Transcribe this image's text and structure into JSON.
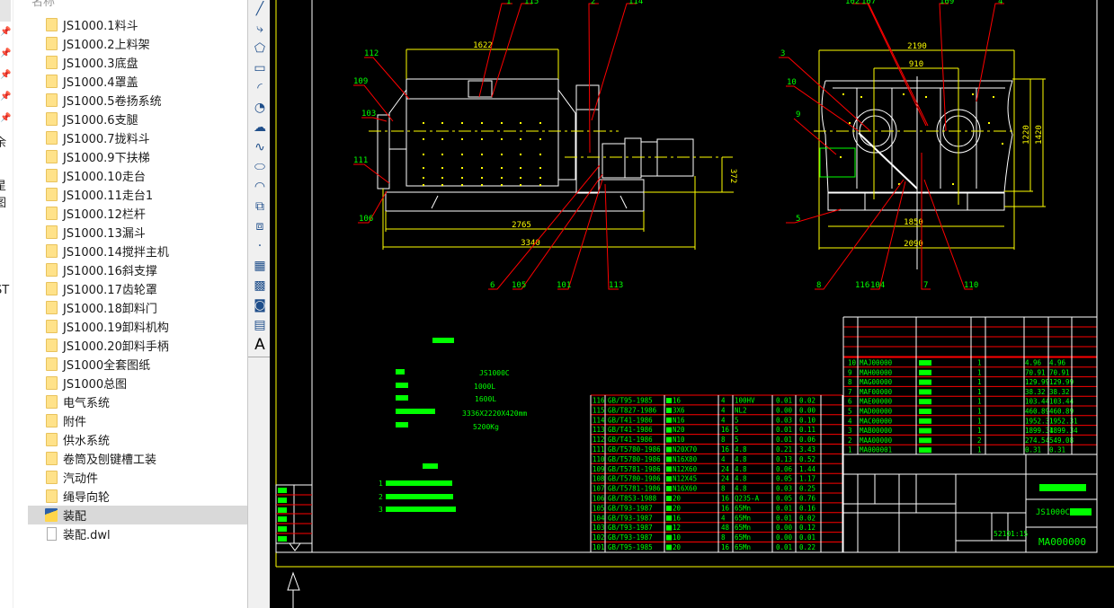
{
  "nav": {
    "fragments": [
      "余",
      "星图",
      "ST"
    ]
  },
  "explorer": {
    "column_header": "名称",
    "items": [
      {
        "label": "JS1000.1料斗",
        "type": "folder"
      },
      {
        "label": "JS1000.2上料架",
        "type": "folder"
      },
      {
        "label": "JS1000.3底盘",
        "type": "folder"
      },
      {
        "label": "JS1000.4罩盖",
        "type": "folder"
      },
      {
        "label": "JS1000.5卷扬系统",
        "type": "folder"
      },
      {
        "label": "JS1000.6支腿",
        "type": "folder"
      },
      {
        "label": "JS1000.7拢料斗",
        "type": "folder"
      },
      {
        "label": "JS1000.9下扶梯",
        "type": "folder"
      },
      {
        "label": "JS1000.10走台",
        "type": "folder"
      },
      {
        "label": "JS1000.11走台1",
        "type": "folder"
      },
      {
        "label": "JS1000.12栏杆",
        "type": "folder"
      },
      {
        "label": "JS1000.13漏斗",
        "type": "folder"
      },
      {
        "label": "JS1000.14搅拌主机",
        "type": "folder"
      },
      {
        "label": "JS1000.16斜支撑",
        "type": "folder"
      },
      {
        "label": "JS1000.17齿轮罩",
        "type": "folder"
      },
      {
        "label": "JS1000.18卸料门",
        "type": "folder"
      },
      {
        "label": "JS1000.19卸料机构",
        "type": "folder"
      },
      {
        "label": "JS1000.20卸料手柄",
        "type": "folder"
      },
      {
        "label": "JS1000全套图纸",
        "type": "folder"
      },
      {
        "label": "JS1000总图",
        "type": "folder"
      },
      {
        "label": "电气系统",
        "type": "folder"
      },
      {
        "label": "附件",
        "type": "folder"
      },
      {
        "label": "供水系统",
        "type": "folder"
      },
      {
        "label": "卷筒及刨键槽工装",
        "type": "folder"
      },
      {
        "label": "汽动件",
        "type": "folder"
      },
      {
        "label": "绳导向轮",
        "type": "folder"
      },
      {
        "label": "装配",
        "type": "dwg",
        "selected": true
      },
      {
        "label": "装配.dwl",
        "type": "file"
      }
    ]
  },
  "toolbar": {
    "tools": [
      {
        "icon": "line-icon",
        "glyph": "╱"
      },
      {
        "icon": "polyline-icon",
        "glyph": "⤷"
      },
      {
        "icon": "polygon-icon",
        "glyph": "⬠"
      },
      {
        "icon": "rectangle-icon",
        "glyph": "▭"
      },
      {
        "icon": "arc-icon",
        "glyph": "◜"
      },
      {
        "icon": "circle-icon",
        "glyph": "◔"
      },
      {
        "icon": "revision-cloud-icon",
        "glyph": "☁"
      },
      {
        "icon": "spline-icon",
        "glyph": "∿"
      },
      {
        "icon": "ellipse-icon",
        "glyph": "⬭"
      },
      {
        "icon": "ellipse-arc-icon",
        "glyph": "◠"
      },
      {
        "icon": "insert-block-icon",
        "glyph": "⧉"
      },
      {
        "icon": "make-block-icon",
        "glyph": "⧈"
      },
      {
        "icon": "point-icon",
        "glyph": "·"
      },
      {
        "icon": "hatch-icon",
        "glyph": "▦"
      },
      {
        "icon": "gradient-icon",
        "glyph": "▩"
      },
      {
        "icon": "region-icon",
        "glyph": "◙"
      },
      {
        "icon": "table-icon",
        "glyph": "▤"
      },
      {
        "icon": "mtext-icon",
        "glyph": "A"
      }
    ]
  },
  "colors": {
    "canvas": "#000000",
    "dimension": "#ffff00",
    "leader": "#ff0000",
    "text": "#00ff00",
    "geometry": "#ffffff"
  },
  "drawing": {
    "front_dims": [
      "1622",
      "2765",
      "3340",
      "372"
    ],
    "side_dims": [
      "2190",
      "910",
      "1850",
      "2090",
      "1220",
      "1420"
    ],
    "front_balloons": [
      "1",
      "115",
      "2",
      "114",
      "112",
      "109",
      "103",
      "111",
      "106",
      "6",
      "105",
      "101",
      "113"
    ],
    "side_balloons": [
      "102",
      "107",
      "109",
      "4",
      "3",
      "10",
      "9",
      "5",
      "8",
      "116",
      "104",
      "7",
      "110"
    ],
    "specs": [
      "JS1000C",
      "1000L",
      "1600L",
      "3336X2220X420mm",
      "5200Kg"
    ],
    "notes": [
      "1",
      "2",
      "3"
    ],
    "parts_list": [
      [
        "116",
        "GB/T95-1985",
        "16",
        "4",
        "100HV",
        "0.01",
        "0.02"
      ],
      [
        "115",
        "GB/T827-1986",
        "3X6",
        "4",
        "NL2",
        "0.00",
        "0.00"
      ],
      [
        "114",
        "GB/T41-1986",
        "N16",
        "4",
        "5",
        "0.03",
        "0.10"
      ],
      [
        "113",
        "GB/T41-1986",
        "N20",
        "16",
        "5",
        "0.01",
        "0.11"
      ],
      [
        "112",
        "GB/T41-1986",
        "N10",
        "8",
        "5",
        "0.01",
        "0.06"
      ],
      [
        "111",
        "GB/T5780-1986",
        "N20X70",
        "16",
        "4.8",
        "0.21",
        "3.43"
      ],
      [
        "110",
        "GB/T5780-1986",
        "N16X80",
        "4",
        "4.8",
        "0.13",
        "0.52"
      ],
      [
        "109",
        "GB/T5781-1986",
        "N12X60",
        "24",
        "4.8",
        "0.06",
        "1.44"
      ],
      [
        "108",
        "GB/T5780-1986",
        "N12X45",
        "24",
        "4.8",
        "0.05",
        "1.17"
      ],
      [
        "107",
        "GB/T5781-1986",
        "N16X60",
        "8",
        "4.8",
        "0.03",
        "0.25"
      ],
      [
        "106",
        "GB/T853-1988",
        "20",
        "16",
        "Q235-A",
        "0.05",
        "0.76"
      ],
      [
        "105",
        "GB/T93-1987",
        "20",
        "16",
        "65Mn",
        "0.01",
        "0.16"
      ],
      [
        "104",
        "GB/T93-1987",
        "16",
        "4",
        "65Mn",
        "0.01",
        "0.02"
      ],
      [
        "103",
        "GB/T93-1987",
        "12",
        "48",
        "65Mn",
        "0.00",
        "0.12"
      ],
      [
        "102",
        "GB/T93-1987",
        "10",
        "8",
        "65Mn",
        "0.00",
        "0.01"
      ],
      [
        "101",
        "GB/T95-1985",
        "20",
        "16",
        "65Mn",
        "0.01",
        "0.22"
      ]
    ],
    "bom": [
      [
        "10",
        "MAJ00000",
        "1",
        "4.96",
        "4.96"
      ],
      [
        "9",
        "MAH00000",
        "1",
        "70.91",
        "70.91"
      ],
      [
        "8",
        "MAG00000",
        "1",
        "129.99",
        "129.99"
      ],
      [
        "7",
        "MAF00000",
        "1",
        "38.32",
        "38.32"
      ],
      [
        "6",
        "MAE00000",
        "1",
        "103.44",
        "103.44"
      ],
      [
        "5",
        "MAD00000",
        "1",
        "460.89",
        "460.89"
      ],
      [
        "4",
        "MAC00000",
        "1",
        "1952.31",
        "1952.31"
      ],
      [
        "3",
        "MAB00000",
        "1",
        "1899.34",
        "1899.34"
      ],
      [
        "2",
        "MAA00000",
        "2",
        "274.54",
        "549.08"
      ],
      [
        "1",
        "MA000001",
        "1",
        "0.31",
        "0.31"
      ]
    ],
    "title_block": {
      "model": "JS1000C",
      "drawing_no": "MA000000",
      "weight": "5210",
      "scale": "1:15"
    }
  }
}
